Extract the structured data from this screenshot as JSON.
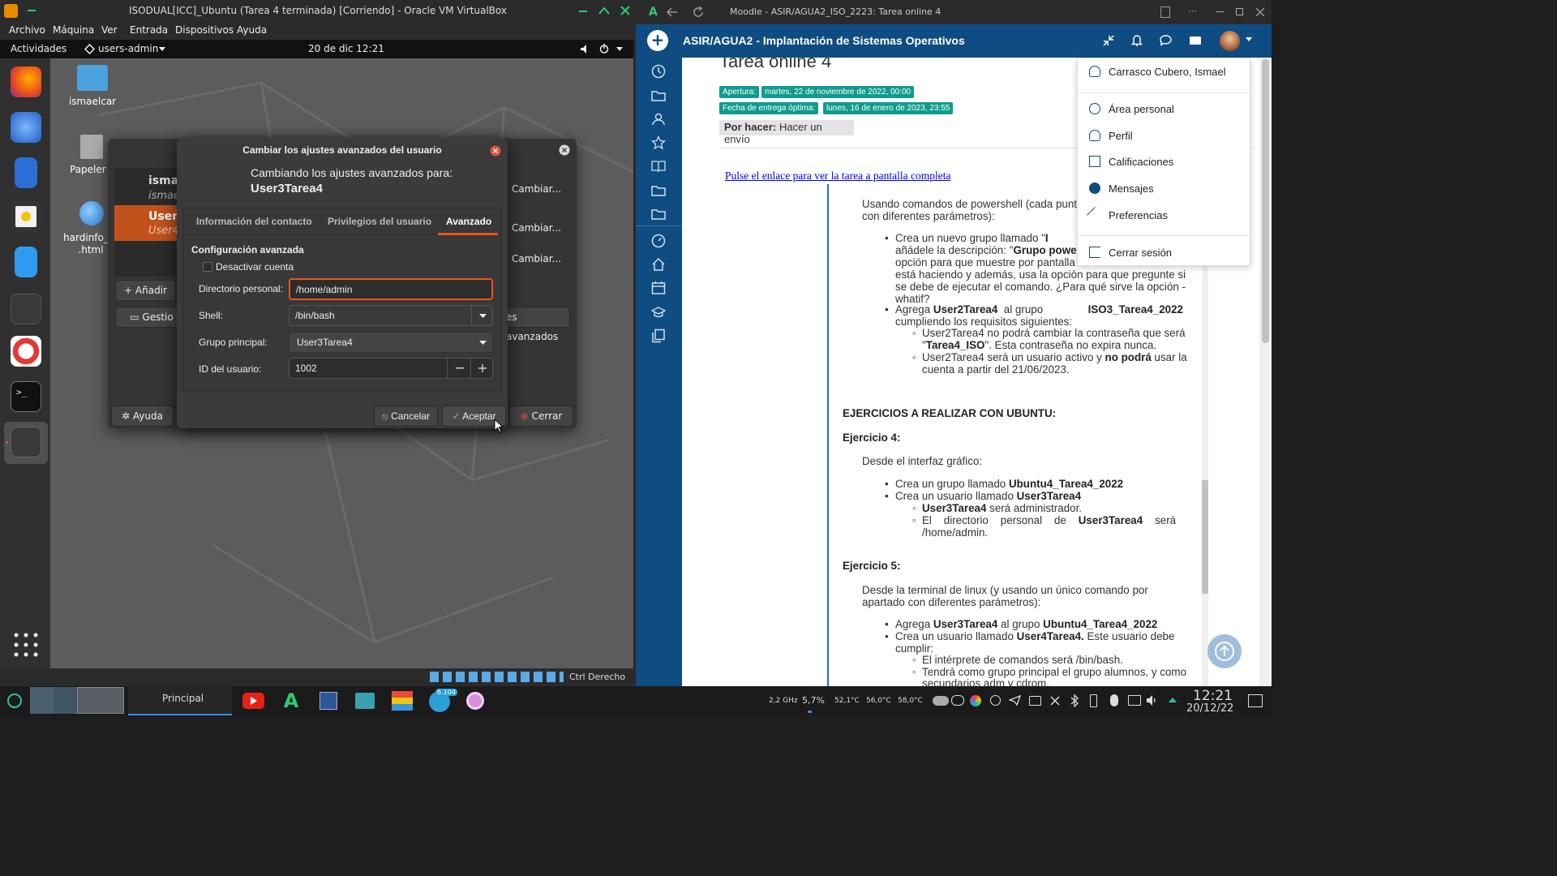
{
  "vbox": {
    "title": "ISODUAL[ICC]_Ubuntu (Tarea 4 terminada) [Corriendo] - Oracle VM VirtualBox",
    "menu": [
      "Archivo",
      "Máquina",
      "Ver",
      "Entrada",
      "Dispositivos",
      "Ayuda"
    ],
    "status_host_key": "Ctrl Derecho"
  },
  "gnome": {
    "activities": "Actividades",
    "app_menu": "users-admin",
    "clock": "20 de dic  12:21"
  },
  "desktop": {
    "icons": [
      "ismaelcar",
      "Papeler",
      "hardinfo_re\n.html"
    ]
  },
  "back_dialog": {
    "user1_name": "ismae",
    "user1_login": "ismae",
    "user2_name": "User3",
    "user2_login": "User4",
    "change": "Cambiar...",
    "add": "Añadir",
    "manage": "Gestio",
    "advanced": "es avanzados",
    "help": "Ayuda",
    "close": "Cerrar"
  },
  "dialog": {
    "title": "Cambiar los ajustes avanzados del usuario",
    "subtitle": "Cambiando los ajustes avanzados para:",
    "user": "User3Tarea4",
    "tabs": [
      "Información del contacto",
      "Privilegios del usuario",
      "Avanzado"
    ],
    "section": "Configuración avanzada",
    "disable_account": "Desactivar cuenta",
    "home_label": "Directorio personal:",
    "home_value": "/home/admin",
    "shell_label": "Shell:",
    "shell_value": "/bin/bash",
    "group_label": "Grupo principal:",
    "group_value": "User3Tarea4",
    "uid_label": "ID del usuario:",
    "uid_value": "1002",
    "cancel": "Cancelar",
    "accept": "Aceptar"
  },
  "browser": {
    "title": "Moodle - ASIR/AGUA2_ISO_2223: Tarea online 4",
    "course": "ASIR/AGUA2 - Implantación de Sistemas Operativos"
  },
  "moodle": {
    "page_title": "Tarea online 4",
    "opening_label": "Apertura:",
    "opening_date": "martes, 22 de noviembre de 2022, 00:00",
    "due_label": "Fecha de entrega óptima:",
    "due_date": "lunes, 16 de enero de 2023, 23:55",
    "todo_label": "Por hacer:",
    "todo_value": "Hacer un envío",
    "link": "Pulse el enlace para ver la tarea a pantalla completa"
  },
  "task_doc": {
    "p1a": "Usando comandos de powershell (cada punt",
    "p1b": "con diferentes parámetros):",
    "b1a_pre": "Crea un nuevo grupo llamado \"",
    "b1a_b": "I",
    "b1b_pre": "añádele la descripción: \"",
    "b1b_b": "Grupo power",
    "b1c": "opción para que muestre por pantalla",
    "b1d": "está haciendo y además, usa la opción para que pregunte si",
    "b1e": "se debe de ejecutar el comando. ¿Para qué sirve la opción -",
    "b1f": "whatif?",
    "b2_pre": "Agrega ",
    "b2_u": "User2Tarea4",
    "b2_mid": "  al grupo ",
    "b2_g": "ISO3_Tarea4_2022",
    "b2b": "cumpliendo los requisitos siguientes:",
    "s1a": "User2Tarea4 no podrá cambiar la contraseña que será",
    "s1b_pre": "\"",
    "s1b_b": "Tarea4_ISO",
    "s1b_post": "\". Esta contraseña no expira nunca.",
    "s2a_pre": "User2Tarea4 será un usuario activo y ",
    "s2a_b": "no podrá",
    "s2a_post": " usar la",
    "s2b": "cuenta a partir del 21/06/2023.",
    "h_ubuntu": "EJERCICIOS A REALIZAR CON UBUNTU:",
    "h_ex4": "Ejercicio 4:",
    "ex4_intro": "Desde el interfaz gráfico:",
    "ex4_b1_pre": "Crea un grupo llamado ",
    "ex4_b1_b": "Ubuntu4_Tarea4_2022",
    "ex4_b2_pre": "Crea un usuario llamado ",
    "ex4_b2_b": "User3Tarea4",
    "ex4_s1_b": "User3Tarea4",
    "ex4_s1_post": " será  administrador.",
    "ex4_s2_pre": "El    directorio    personal    de    ",
    "ex4_s2_b": "User3Tarea4",
    "ex4_s2_post": "    será",
    "ex4_s2b": "/home/admin.",
    "h_ex5": "Ejercicio 5:",
    "ex5_intro_a": "Desde la terminal de linux (y usando un único comando por",
    "ex5_intro_b": "apartado con diferentes parámetros):",
    "ex5_b1_pre": "Agrega ",
    "ex5_b1_u": "User3Tarea4",
    "ex5_b1_mid": " al grupo ",
    "ex5_b1_g": "Ubuntu4_Tarea4_2022",
    "ex5_b2_pre": "Crea un usuario llamado ",
    "ex5_b2_b": "User4Tarea4.",
    "ex5_b2_post": " Este usuario debe",
    "ex5_b2b": "cumplir:",
    "ex5_s1": "El intérprete de comandos será /bin/bash.",
    "ex5_s2a": "Tendrá como grupo principal el grupo alumnos, y como",
    "ex5_s2b": "secundarios adm y cdrom."
  },
  "user_menu": {
    "name": "Carrasco Cubero, Ismael",
    "items": [
      "Área personal",
      "Perfil",
      "Calificaciones",
      "Mensajes",
      "Preferencias"
    ],
    "logout": "Cerrar sesión"
  },
  "taskbar": {
    "principal": "Principal",
    "badge": "6.104",
    "cpu_freq": "2,2 GHz",
    "cpu_pct": "5,7%",
    "temp1": "52,1°C",
    "temp2": "56,0°C",
    "temp3": "58,0°C",
    "time": "12:21",
    "date": "20/12/22"
  }
}
